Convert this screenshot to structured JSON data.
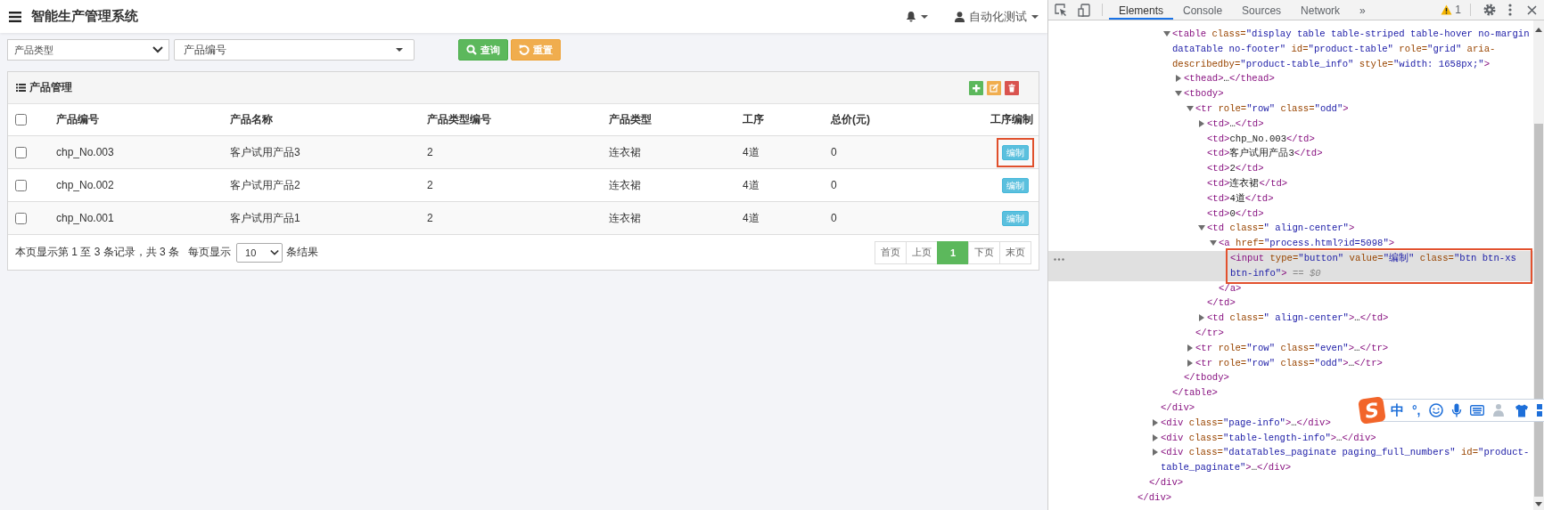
{
  "app": {
    "title": "智能生产管理系统",
    "user": "自动化测试",
    "filters": {
      "product_type": "产品类型",
      "product_code": "产品编号",
      "buttons": [
        {
          "kind": "search",
          "label": "查询"
        },
        {
          "kind": "reset",
          "label": "重置"
        }
      ]
    },
    "panel": {
      "title": "产品管理",
      "tools": [
        {
          "kind": "add"
        },
        {
          "kind": "edit"
        },
        {
          "kind": "delete"
        }
      ],
      "table": {
        "select_all": {
          "checked": false
        },
        "columns": [
          "产品编号",
          "产品名称",
          "产品类型编号",
          "产品类型",
          "工序",
          "总价(元)",
          "工序编制"
        ],
        "rows": [
          {
            "checked": false,
            "cells": [
              "chp_No.003",
              "客户试用产品3",
              "2",
              "连衣裙",
              "4道",
              "0"
            ],
            "action": "编制",
            "annotated": true
          },
          {
            "checked": false,
            "cells": [
              "chp_No.002",
              "客户试用产品2",
              "2",
              "连衣裙",
              "4道",
              "0"
            ],
            "action": "编制",
            "annotated": false
          },
          {
            "checked": false,
            "cells": [
              "chp_No.001",
              "客户试用产品1",
              "2",
              "连衣裙",
              "4道",
              "0"
            ],
            "action": "编制",
            "annotated": false
          }
        ]
      },
      "footer": {
        "info": "本页显示第 1 至 3 条记录，共 3 条",
        "per_page_label": "每页显示",
        "per_page": "10",
        "per_page_suffix": "条结果",
        "pages": [
          {
            "label": "首页",
            "selected": false
          },
          {
            "label": "上页",
            "selected": false
          },
          {
            "label": "1",
            "selected": true
          },
          {
            "label": "下页",
            "selected": false
          },
          {
            "label": "末页",
            "selected": false
          }
        ]
      }
    }
  },
  "devtools": {
    "tabs": [
      {
        "label": "Elements",
        "selected": true
      },
      {
        "label": "Console",
        "selected": false
      },
      {
        "label": "Sources",
        "selected": false
      },
      {
        "label": "Network",
        "selected": false
      }
    ],
    "more": "»",
    "warnings": "1",
    "tree": {
      "close": [
        {
          "kind": "tag",
          "text": "</div>"
        }
      ],
      "children": [
        {
          "close": [
            {
              "kind": "tag",
              "text": "</div>"
            }
          ],
          "children": [
            {
              "close": [
                {
                  "kind": "tag",
                  "text": "</div>"
                }
              ],
              "children": [
                {
                  "expanded": true,
                  "selected": false,
                  "open": [
                    {
                      "kind": "tag",
                      "text": "<table"
                    },
                    {
                      "kind": "attr",
                      "text": " class="
                    },
                    {
                      "kind": "value",
                      "text": "\"display table table-striped table-hover no-margin dataTable no-footer\""
                    },
                    {
                      "kind": "attr",
                      "text": " id="
                    },
                    {
                      "kind": "value",
                      "text": "\"product-table\""
                    },
                    {
                      "kind": "attr",
                      "text": " role="
                    },
                    {
                      "kind": "value",
                      "text": "\"grid\""
                    },
                    {
                      "kind": "attr",
                      "text": " aria-describedby="
                    },
                    {
                      "kind": "value",
                      "text": "\"product-table_info\""
                    },
                    {
                      "kind": "attr",
                      "text": " style="
                    },
                    {
                      "kind": "value",
                      "text": "\"width: 1658px;\""
                    },
                    {
                      "kind": "tag",
                      "text": ">"
                    }
                  ],
                  "close": [
                    {
                      "kind": "tag",
                      "text": "</table>"
                    }
                  ],
                  "children": [
                    {
                      "expanded": false,
                      "selected": false,
                      "open": [
                        {
                          "kind": "tag",
                          "text": "<thead>"
                        },
                        {
                          "kind": "text",
                          "text": "…"
                        },
                        {
                          "kind": "tag",
                          "text": "</thead>"
                        }
                      ]
                    },
                    {
                      "expanded": true,
                      "selected": false,
                      "open": [
                        {
                          "kind": "tag",
                          "text": "<tbody>"
                        }
                      ],
                      "close": [
                        {
                          "kind": "tag",
                          "text": "</tbody>"
                        }
                      ],
                      "children": [
                        {
                          "expanded": true,
                          "selected": false,
                          "open": [
                            {
                              "kind": "tag",
                              "text": "<tr"
                            },
                            {
                              "kind": "attr",
                              "text": " role="
                            },
                            {
                              "kind": "value",
                              "text": "\"row\""
                            },
                            {
                              "kind": "attr",
                              "text": " class="
                            },
                            {
                              "kind": "value",
                              "text": "\"odd\""
                            },
                            {
                              "kind": "tag",
                              "text": ">"
                            }
                          ],
                          "close": [
                            {
                              "kind": "tag",
                              "text": "</tr>"
                            }
                          ],
                          "children": [
                            {
                              "expanded": false,
                              "selected": false,
                              "open": [
                                {
                                  "kind": "tag",
                                  "text": "<td>"
                                },
                                {
                                  "kind": "text",
                                  "text": "…"
                                },
                                {
                                  "kind": "tag",
                                  "text": "</td>"
                                }
                              ]
                            },
                            {
                              "selected": false,
                              "open": [
                                {
                                  "kind": "tag",
                                  "text": "<td>"
                                },
                                {
                                  "kind": "text",
                                  "text": "chp_No.003"
                                },
                                {
                                  "kind": "tag",
                                  "text": "</td>"
                                }
                              ]
                            },
                            {
                              "selected": false,
                              "open": [
                                {
                                  "kind": "tag",
                                  "text": "<td>"
                                },
                                {
                                  "kind": "text",
                                  "text": "客户试用产品3"
                                },
                                {
                                  "kind": "tag",
                                  "text": "</td>"
                                }
                              ]
                            },
                            {
                              "selected": false,
                              "open": [
                                {
                                  "kind": "tag",
                                  "text": "<td>"
                                },
                                {
                                  "kind": "text",
                                  "text": "2"
                                },
                                {
                                  "kind": "tag",
                                  "text": "</td>"
                                }
                              ]
                            },
                            {
                              "selected": false,
                              "open": [
                                {
                                  "kind": "tag",
                                  "text": "<td>"
                                },
                                {
                                  "kind": "text",
                                  "text": "连衣裙"
                                },
                                {
                                  "kind": "tag",
                                  "text": "</td>"
                                }
                              ]
                            },
                            {
                              "selected": false,
                              "open": [
                                {
                                  "kind": "tag",
                                  "text": "<td>"
                                },
                                {
                                  "kind": "text",
                                  "text": "4道"
                                },
                                {
                                  "kind": "tag",
                                  "text": "</td>"
                                }
                              ]
                            },
                            {
                              "selected": false,
                              "open": [
                                {
                                  "kind": "tag",
                                  "text": "<td>"
                                },
                                {
                                  "kind": "text",
                                  "text": "0"
                                },
                                {
                                  "kind": "tag",
                                  "text": "</td>"
                                }
                              ]
                            },
                            {
                              "expanded": true,
                              "selected": false,
                              "open": [
                                {
                                  "kind": "tag",
                                  "text": "<td"
                                },
                                {
                                  "kind": "attr",
                                  "text": " class="
                                },
                                {
                                  "kind": "value",
                                  "text": "\" align-center\""
                                },
                                {
                                  "kind": "tag",
                                  "text": ">"
                                }
                              ],
                              "close": [
                                {
                                  "kind": "tag",
                                  "text": "</td>"
                                }
                              ],
                              "children": [
                                {
                                  "expanded": true,
                                  "selected": false,
                                  "open": [
                                    {
                                      "kind": "tag",
                                      "text": "<a"
                                    },
                                    {
                                      "kind": "attr",
                                      "text": " href="
                                    },
                                    {
                                      "kind": "value",
                                      "text": "\"process.html?id=5098\""
                                    },
                                    {
                                      "kind": "tag",
                                      "text": ">"
                                    }
                                  ],
                                  "close": [
                                    {
                                      "kind": "tag",
                                      "text": "</a>"
                                    }
                                  ],
                                  "children": [
                                    {
                                      "selected": true,
                                      "annotated": true,
                                      "open": [
                                        {
                                          "kind": "tag",
                                          "text": "<input"
                                        },
                                        {
                                          "kind": "attr",
                                          "text": " type="
                                        },
                                        {
                                          "kind": "value",
                                          "text": "\"button\""
                                        },
                                        {
                                          "kind": "attr",
                                          "text": " value="
                                        },
                                        {
                                          "kind": "value",
                                          "text": "\"编制\""
                                        },
                                        {
                                          "kind": "attr",
                                          "text": " class="
                                        },
                                        {
                                          "kind": "value",
                                          "text": "\"btn btn-xs btn-info\""
                                        },
                                        {
                                          "kind": "tag",
                                          "text": ">"
                                        },
                                        {
                                          "kind": "hint",
                                          "text": " == $0"
                                        }
                                      ]
                                    }
                                  ]
                                }
                              ]
                            },
                            {
                              "expanded": false,
                              "selected": false,
                              "open": [
                                {
                                  "kind": "tag",
                                  "text": "<td"
                                },
                                {
                                  "kind": "attr",
                                  "text": " class="
                                },
                                {
                                  "kind": "value",
                                  "text": "\" align-center\""
                                },
                                {
                                  "kind": "tag",
                                  "text": ">"
                                },
                                {
                                  "kind": "text",
                                  "text": "…"
                                },
                                {
                                  "kind": "tag",
                                  "text": "</td>"
                                }
                              ]
                            }
                          ]
                        },
                        {
                          "expanded": false,
                          "selected": false,
                          "open": [
                            {
                              "kind": "tag",
                              "text": "<tr"
                            },
                            {
                              "kind": "attr",
                              "text": " role="
                            },
                            {
                              "kind": "value",
                              "text": "\"row\""
                            },
                            {
                              "kind": "attr",
                              "text": " class="
                            },
                            {
                              "kind": "value",
                              "text": "\"even\""
                            },
                            {
                              "kind": "tag",
                              "text": ">"
                            },
                            {
                              "kind": "text",
                              "text": "…"
                            },
                            {
                              "kind": "tag",
                              "text": "</tr>"
                            }
                          ]
                        },
                        {
                          "expanded": false,
                          "selected": false,
                          "open": [
                            {
                              "kind": "tag",
                              "text": "<tr"
                            },
                            {
                              "kind": "attr",
                              "text": " role="
                            },
                            {
                              "kind": "value",
                              "text": "\"row\""
                            },
                            {
                              "kind": "attr",
                              "text": " class="
                            },
                            {
                              "kind": "value",
                              "text": "\"odd\""
                            },
                            {
                              "kind": "tag",
                              "text": ">"
                            },
                            {
                              "kind": "text",
                              "text": "…"
                            },
                            {
                              "kind": "tag",
                              "text": "</tr>"
                            }
                          ]
                        }
                      ]
                    }
                  ]
                }
              ]
            },
            {
              "expanded": false,
              "selected": false,
              "open": [
                {
                  "kind": "tag",
                  "text": "<div"
                },
                {
                  "kind": "attr",
                  "text": " class="
                },
                {
                  "kind": "value",
                  "text": "\"page-info\""
                },
                {
                  "kind": "tag",
                  "text": ">"
                },
                {
                  "kind": "text",
                  "text": "…"
                },
                {
                  "kind": "tag",
                  "text": "</div>"
                }
              ]
            },
            {
              "expanded": false,
              "selected": false,
              "open": [
                {
                  "kind": "tag",
                  "text": "<div"
                },
                {
                  "kind": "attr",
                  "text": " class="
                },
                {
                  "kind": "value",
                  "text": "\"table-length-info\""
                },
                {
                  "kind": "tag",
                  "text": ">"
                },
                {
                  "kind": "text",
                  "text": "…"
                },
                {
                  "kind": "tag",
                  "text": "</div>"
                }
              ]
            },
            {
              "expanded": false,
              "selected": false,
              "open": [
                {
                  "kind": "tag",
                  "text": "<div"
                },
                {
                  "kind": "attr",
                  "text": " class="
                },
                {
                  "kind": "value",
                  "text": "\"dataTables_paginate paging_full_numbers\""
                },
                {
                  "kind": "attr",
                  "text": " id="
                },
                {
                  "kind": "value",
                  "text": "\"product-table_paginate\""
                },
                {
                  "kind": "tag",
                  "text": ">"
                },
                {
                  "kind": "text",
                  "text": "…"
                },
                {
                  "kind": "tag",
                  "text": "</div>"
                }
              ]
            }
          ]
        }
      ]
    },
    "ime": {
      "logo": "S",
      "mode": "中",
      "punctuation": "°,"
    }
  }
}
